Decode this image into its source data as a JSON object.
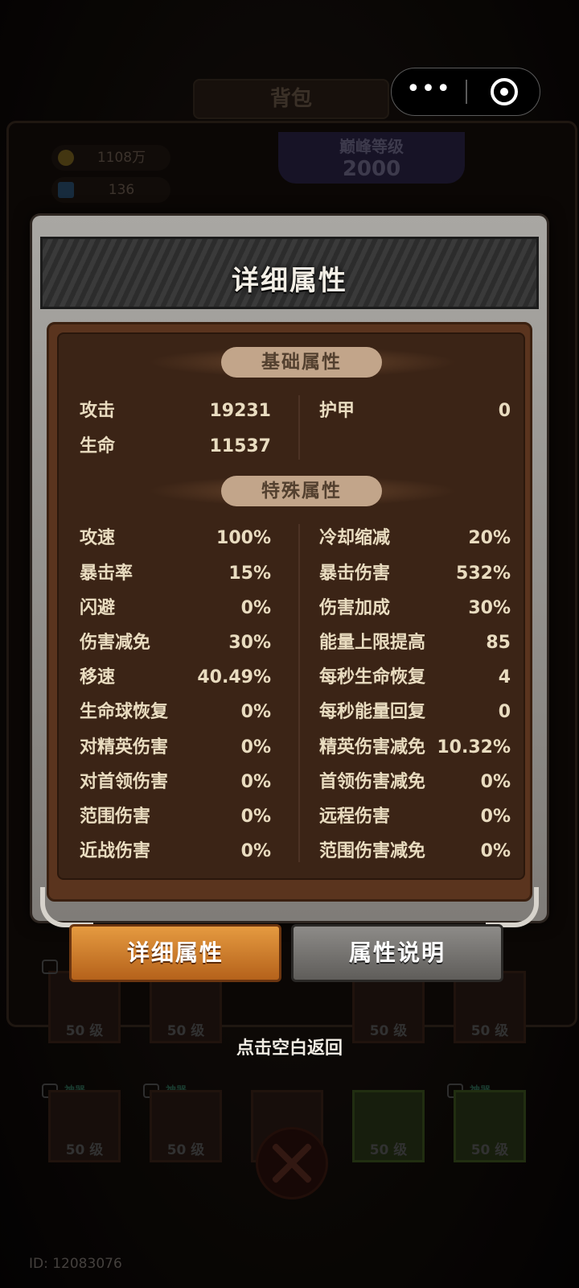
{
  "background": {
    "tab_label": "背包",
    "gold": "1108万",
    "gems": "136",
    "peak_level_title": "巅峰等级",
    "peak_level_value": "2000",
    "slot_level_label": "50 级",
    "shen_badge": "神器",
    "user_id": "ID: 12083076"
  },
  "capsule": {
    "more_label": "•••"
  },
  "modal": {
    "title": "详细属性",
    "basic_section": "基础属性",
    "special_section": "特殊属性",
    "basic_stats": [
      {
        "label": "攻击",
        "value": "19231"
      },
      {
        "label": "护甲",
        "value": "0"
      },
      {
        "label": "生命",
        "value": "11537"
      }
    ],
    "special_stats_left": [
      {
        "label": "攻速",
        "value": "100%"
      },
      {
        "label": "暴击率",
        "value": "15%"
      },
      {
        "label": "闪避",
        "value": "0%"
      },
      {
        "label": "伤害减免",
        "value": "30%"
      },
      {
        "label": "移速",
        "value": "40.49%"
      },
      {
        "label": "生命球恢复",
        "value": "0%"
      },
      {
        "label": "对精英伤害",
        "value": "0%"
      },
      {
        "label": "对首领伤害",
        "value": "0%"
      },
      {
        "label": "范围伤害",
        "value": "0%"
      },
      {
        "label": "近战伤害",
        "value": "0%"
      }
    ],
    "special_stats_right": [
      {
        "label": "冷却缩减",
        "value": "20%"
      },
      {
        "label": "暴击伤害",
        "value": "532%"
      },
      {
        "label": "伤害加成",
        "value": "30%"
      },
      {
        "label": "能量上限提高",
        "value": "85"
      },
      {
        "label": "每秒生命恢复",
        "value": "4"
      },
      {
        "label": "每秒能量回复",
        "value": "0"
      },
      {
        "label": "精英伤害减免",
        "value": "10.32%"
      },
      {
        "label": "首领伤害减免",
        "value": "0%"
      },
      {
        "label": "远程伤害",
        "value": "0%"
      },
      {
        "label": "范围伤害减免",
        "value": "0%"
      }
    ]
  },
  "buttons": {
    "detail": "详细属性",
    "explain": "属性说明"
  },
  "hint": "点击空白返回"
}
